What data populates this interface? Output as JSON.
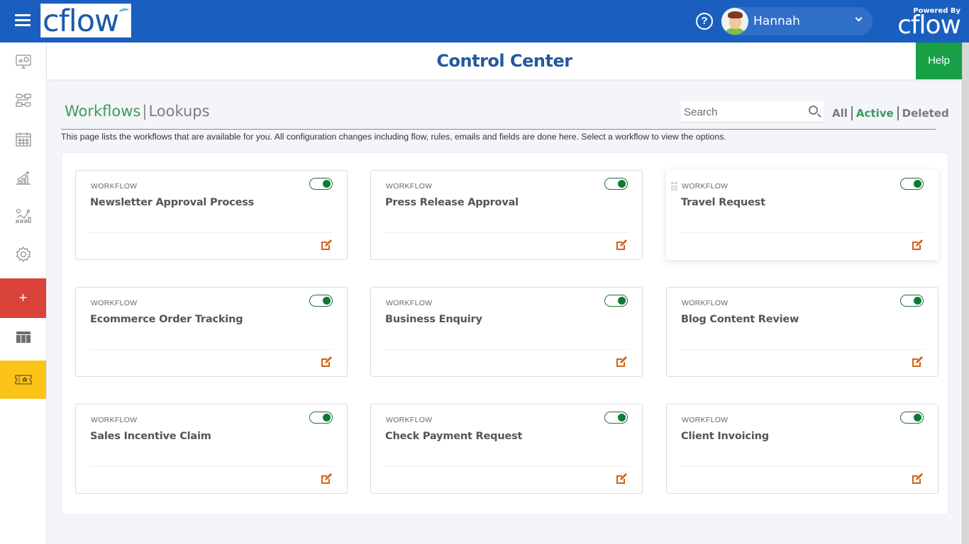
{
  "topbar": {
    "logo_text": "cflow",
    "help_icon_glyph": "?",
    "user": {
      "name": "Hannah",
      "avatar": "user-avatar"
    },
    "powered_by_label": "Powered By",
    "powered_by_logo": "cflow"
  },
  "sidebar": {
    "items": [
      {
        "name": "dashboard",
        "icon": "monitor-chart-icon"
      },
      {
        "name": "workflow-designer",
        "icon": "flow-diagram-icon"
      },
      {
        "name": "calendar",
        "icon": "calendar-icon"
      },
      {
        "name": "reports",
        "icon": "bar-chart-growth-icon"
      },
      {
        "name": "analytics",
        "icon": "line-chart-icon"
      },
      {
        "name": "settings",
        "icon": "gear-icon"
      },
      {
        "name": "create-new",
        "icon": "plus-icon",
        "glyph": "+"
      },
      {
        "name": "table-view",
        "icon": "table-icon"
      },
      {
        "name": "tickets",
        "icon": "ticket-star-icon"
      }
    ]
  },
  "header": {
    "title": "Control Center",
    "help_label": "Help"
  },
  "tabs": {
    "workflows": "Workflows",
    "separator": "|",
    "lookups": "Lookups"
  },
  "search": {
    "placeholder": "Search",
    "value": ""
  },
  "filters": {
    "all": "All",
    "active": "Active",
    "deleted": "Deleted",
    "selected": "Active"
  },
  "description": "This page lists the workflows that are available for you. All configuration changes including flow, rules, emails and fields are done here. Select a workflow to view the options.",
  "colors": {
    "topbar": "#1a5fbf",
    "accent_green": "#3f9a5c",
    "help_button": "#17a045",
    "title_blue": "#23599d",
    "edit_icon": "#d2601a",
    "add_button": "#d9433a",
    "ticket_button": "#fcc419"
  },
  "workflows": [
    {
      "label": "WORKFLOW",
      "title": "Newsletter Approval Process",
      "enabled": true
    },
    {
      "label": "WORKFLOW",
      "title": "Press Release Approval",
      "enabled": true
    },
    {
      "label": "WORKFLOW",
      "title": "Travel Request",
      "enabled": true,
      "hovered": true
    },
    {
      "label": "WORKFLOW",
      "title": "Ecommerce Order Tracking",
      "enabled": true
    },
    {
      "label": "WORKFLOW",
      "title": "Business Enquiry",
      "enabled": true
    },
    {
      "label": "WORKFLOW",
      "title": "Blog Content Review",
      "enabled": true
    },
    {
      "label": "WORKFLOW",
      "title": "Sales Incentive Claim",
      "enabled": true
    },
    {
      "label": "WORKFLOW",
      "title": "Check Payment Request",
      "enabled": true
    },
    {
      "label": "WORKFLOW",
      "title": "Client Invoicing",
      "enabled": true
    }
  ]
}
